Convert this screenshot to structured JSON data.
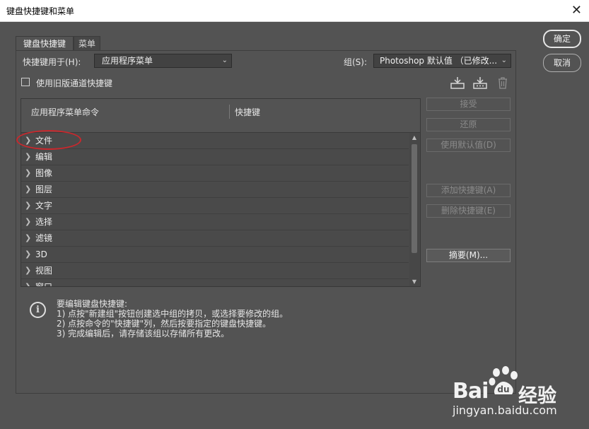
{
  "window": {
    "title": "键盘快捷键和菜单",
    "close_symbol": "✕"
  },
  "tabs": [
    {
      "label": "键盘快捷键",
      "active": true
    },
    {
      "label": "菜单",
      "active": false
    }
  ],
  "shortcuts_for": {
    "label": "快捷键用于(H):",
    "value": "应用程序菜单"
  },
  "group": {
    "label": "组(S):",
    "value": "Photoshop 默认值 （已修改..."
  },
  "legacy_checkbox": {
    "label": "使用旧版通道快捷键",
    "checked": false
  },
  "table": {
    "col_command": "应用程序菜单命令",
    "col_shortcut": "快捷键",
    "rows": [
      {
        "label": "文件"
      },
      {
        "label": "编辑"
      },
      {
        "label": "图像"
      },
      {
        "label": "图层"
      },
      {
        "label": "文字"
      },
      {
        "label": "选择"
      },
      {
        "label": "滤镜"
      },
      {
        "label": "3D"
      },
      {
        "label": "视图"
      },
      {
        "label": "窗口"
      }
    ]
  },
  "side_buttons": {
    "accept": "接受",
    "undo": "还原",
    "use_default": "使用默认值(D)",
    "add_shortcut": "添加快捷键(A)",
    "delete_shortcut": "删除快捷键(E)",
    "summarize": "摘要(M)..."
  },
  "dialog_buttons": {
    "ok": "确定",
    "cancel": "取消"
  },
  "info": {
    "lines": [
      "要编辑键盘快捷键:",
      "1) 点按\"新建组\"按钮创建选中组的拷贝，或选择要修改的组。",
      "2) 点按命令的\"快捷键\"列，然后按要指定的键盘快捷键。",
      "3) 完成编辑后，请存储该组以存储所有更改。"
    ]
  },
  "watermark": {
    "brand": "Bai",
    "brand2": "经验",
    "url": "jingyan.baidu.com"
  }
}
